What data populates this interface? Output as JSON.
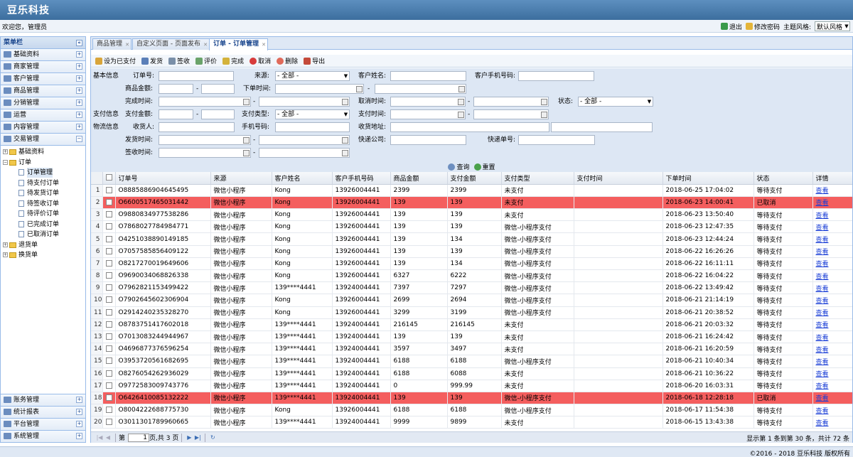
{
  "app": {
    "title": "豆乐科技"
  },
  "topbar": {
    "welcome": "欢迎您，管理员",
    "logout": "退出",
    "change_password": "修改密码",
    "theme_label": "主题风格:",
    "theme_value": "默认风格"
  },
  "sidebar": {
    "title": "菜单栏",
    "menu": [
      "基础资料",
      "商家管理",
      "客户管理",
      "商品管理",
      "分销管理",
      "运营",
      "内容管理",
      "交易管理"
    ],
    "tree": {
      "basic": "基础资料",
      "order": "订单",
      "order_children": [
        "订单管理",
        "待支付订单",
        "待发货订单",
        "待签收订单",
        "待评价订单",
        "已完成订单",
        "已取消订单"
      ],
      "refund": "退货单",
      "exchange": "换货单"
    },
    "bottom_menu": [
      "账务管理",
      "统计报表",
      "平台管理",
      "系统管理"
    ]
  },
  "tabs": [
    {
      "label": "商品管理"
    },
    {
      "label": "自定义页面 - 页面发布"
    },
    {
      "label": "订单 - 订单管理"
    }
  ],
  "toolbar": [
    "设为已支付",
    "发货",
    "签收",
    "评价",
    "完成",
    "取消",
    "删除",
    "导出"
  ],
  "form": {
    "basic_info": "基本信息",
    "order_no": "订单号:",
    "source": "来源:",
    "source_value": "- 全部 -",
    "customer_name": "客户姓名:",
    "customer_phone": "客户手机号码:",
    "amount": "商品金额:",
    "order_time": "下单时间:",
    "finish_time": "完成时间:",
    "cancel_time": "取消时间:",
    "status": "状态:",
    "status_value": "- 全部 -",
    "pay_info": "支付信息",
    "pay_amount": "支付金额:",
    "pay_type": "支付类型:",
    "pay_type_value": "- 全部 -",
    "pay_time": "支付时间:",
    "logistics_info": "物流信息",
    "receiver": "收货人:",
    "mobile": "手机号码:",
    "address": "收货地址:",
    "ship_time": "发货时间:",
    "express_company": "快递公司:",
    "express_no": "快递单号:",
    "sign_time": "签收时间:",
    "dash": "-",
    "query": "查询",
    "reset": "重置"
  },
  "grid": {
    "columns": [
      "订单号",
      "来源",
      "客户姓名",
      "客户手机号码",
      "商品金额",
      "支付金额",
      "支付类型",
      "支付时间",
      "下单时间",
      "状态",
      "详情"
    ],
    "rows": [
      {
        "n": "1",
        "id": "O8885886904645495",
        "src": "微信小程序",
        "name": "Kong",
        "phone": "13926004441",
        "amt": "2399",
        "pay": "2399",
        "ptype": "未支付",
        "ptime": "",
        "otime": "2018-06-25 17:04:02",
        "status": "等待支付",
        "detail": "查看",
        "hl": false
      },
      {
        "n": "2",
        "id": "O6600517465031442",
        "src": "微信小程序",
        "name": "Kong",
        "phone": "13926004441",
        "amt": "139",
        "pay": "139",
        "ptype": "未支付",
        "ptime": "",
        "otime": "2018-06-23 14:00:41",
        "status": "已取消",
        "detail": "查看",
        "hl": true
      },
      {
        "n": "3",
        "id": "O9880834977538286",
        "src": "微信小程序",
        "name": "Kong",
        "phone": "13926004441",
        "amt": "139",
        "pay": "139",
        "ptype": "未支付",
        "ptime": "",
        "otime": "2018-06-23 13:50:40",
        "status": "等待支付",
        "detail": "查看",
        "hl": false
      },
      {
        "n": "4",
        "id": "O7868027784984771",
        "src": "微信小程序",
        "name": "Kong",
        "phone": "13926004441",
        "amt": "139",
        "pay": "139",
        "ptype": "微信-小程序支付",
        "ptime": "",
        "otime": "2018-06-23 12:47:35",
        "status": "等待支付",
        "detail": "查看",
        "hl": false
      },
      {
        "n": "5",
        "id": "O4251038890149185",
        "src": "微信小程序",
        "name": "Kong",
        "phone": "13926004441",
        "amt": "139",
        "pay": "134",
        "ptype": "微信-小程序支付",
        "ptime": "",
        "otime": "2018-06-23 12:44:24",
        "status": "等待支付",
        "detail": "查看",
        "hl": false
      },
      {
        "n": "6",
        "id": "O7057585856409122",
        "src": "微信小程序",
        "name": "Kong",
        "phone": "13926004441",
        "amt": "139",
        "pay": "139",
        "ptype": "微信-小程序支付",
        "ptime": "",
        "otime": "2018-06-22 16:26:26",
        "status": "等待支付",
        "detail": "查看",
        "hl": false
      },
      {
        "n": "7",
        "id": "O8217270019649606",
        "src": "微信小程序",
        "name": "Kong",
        "phone": "13926004441",
        "amt": "139",
        "pay": "134",
        "ptype": "微信-小程序支付",
        "ptime": "",
        "otime": "2018-06-22 16:11:11",
        "status": "等待支付",
        "detail": "查看",
        "hl": false
      },
      {
        "n": "8",
        "id": "O9690034068826338",
        "src": "微信小程序",
        "name": "Kong",
        "phone": "13926004441",
        "amt": "6327",
        "pay": "6222",
        "ptype": "微信-小程序支付",
        "ptime": "",
        "otime": "2018-06-22 16:04:22",
        "status": "等待支付",
        "detail": "查看",
        "hl": false
      },
      {
        "n": "9",
        "id": "O7962821153499422",
        "src": "微信小程序",
        "name": "139****4441",
        "phone": "13924004441",
        "amt": "7397",
        "pay": "7297",
        "ptype": "微信-小程序支付",
        "ptime": "",
        "otime": "2018-06-22 13:49:42",
        "status": "等待支付",
        "detail": "查看",
        "hl": false
      },
      {
        "n": "10",
        "id": "O7902645602306904",
        "src": "微信小程序",
        "name": "Kong",
        "phone": "13926004441",
        "amt": "2699",
        "pay": "2694",
        "ptype": "微信-小程序支付",
        "ptime": "",
        "otime": "2018-06-21 21:14:19",
        "status": "等待支付",
        "detail": "查看",
        "hl": false
      },
      {
        "n": "11",
        "id": "O2914240235328270",
        "src": "微信小程序",
        "name": "Kong",
        "phone": "13926004441",
        "amt": "3299",
        "pay": "3199",
        "ptype": "微信-小程序支付",
        "ptime": "",
        "otime": "2018-06-21 20:38:52",
        "status": "等待支付",
        "detail": "查看",
        "hl": false
      },
      {
        "n": "12",
        "id": "O8783751417602018",
        "src": "微信小程序",
        "name": "139****4441",
        "phone": "13924004441",
        "amt": "216145",
        "pay": "216145",
        "ptype": "未支付",
        "ptime": "",
        "otime": "2018-06-21 20:03:32",
        "status": "等待支付",
        "detail": "查看",
        "hl": false
      },
      {
        "n": "13",
        "id": "O7013083244944967",
        "src": "微信小程序",
        "name": "139****4441",
        "phone": "13924004441",
        "amt": "139",
        "pay": "139",
        "ptype": "未支付",
        "ptime": "",
        "otime": "2018-06-21 16:24:42",
        "status": "等待支付",
        "detail": "查看",
        "hl": false
      },
      {
        "n": "14",
        "id": "O4696877376596254",
        "src": "微信小程序",
        "name": "139****4441",
        "phone": "13924004441",
        "amt": "3597",
        "pay": "3497",
        "ptype": "未支付",
        "ptime": "",
        "otime": "2018-06-21 16:20:59",
        "status": "等待支付",
        "detail": "查看",
        "hl": false
      },
      {
        "n": "15",
        "id": "O3953720561682695",
        "src": "微信小程序",
        "name": "139****4441",
        "phone": "13924004441",
        "amt": "6188",
        "pay": "6188",
        "ptype": "微信-小程序支付",
        "ptime": "",
        "otime": "2018-06-21 10:40:34",
        "status": "等待支付",
        "detail": "查看",
        "hl": false
      },
      {
        "n": "16",
        "id": "O8276054262936029",
        "src": "微信小程序",
        "name": "139****4441",
        "phone": "13924004441",
        "amt": "6188",
        "pay": "6088",
        "ptype": "未支付",
        "ptime": "",
        "otime": "2018-06-21 10:36:22",
        "status": "等待支付",
        "detail": "查看",
        "hl": false
      },
      {
        "n": "17",
        "id": "O9772583009743776",
        "src": "微信小程序",
        "name": "139****4441",
        "phone": "13924004441",
        "amt": "0",
        "pay": "999.99",
        "ptype": "未支付",
        "ptime": "",
        "otime": "2018-06-20 16:03:31",
        "status": "等待支付",
        "detail": "查看",
        "hl": false
      },
      {
        "n": "18",
        "id": "O6426410085132222",
        "src": "微信小程序",
        "name": "139****4441",
        "phone": "13924004441",
        "amt": "139",
        "pay": "139",
        "ptype": "微信-小程序支付",
        "ptime": "",
        "otime": "2018-06-18 12:28:18",
        "status": "已取消",
        "detail": "查看",
        "hl": true
      },
      {
        "n": "19",
        "id": "O8004222688775730",
        "src": "微信小程序",
        "name": "Kong",
        "phone": "13926004441",
        "amt": "6188",
        "pay": "6188",
        "ptype": "微信-小程序支付",
        "ptime": "",
        "otime": "2018-06-17 11:54:38",
        "status": "等待支付",
        "detail": "查看",
        "hl": false
      },
      {
        "n": "20",
        "id": "O3011301789960665",
        "src": "微信小程序",
        "name": "139****4441",
        "phone": "13924004441",
        "amt": "9999",
        "pay": "9899",
        "ptype": "未支付",
        "ptime": "",
        "otime": "2018-06-15 13:43:38",
        "status": "等待支付",
        "detail": "查看",
        "hl": false
      }
    ]
  },
  "pager": {
    "label_page": "第",
    "page": "1",
    "label_total": "页,共 3 页",
    "info": "显示第 1 条到第 30 条，共计 72 条"
  },
  "footer": {
    "copyright": "©2016 - 2018 豆乐科技 版权所有"
  },
  "colors": {
    "header": "#4a7db0",
    "highlight_row": "#f45e5e",
    "link": "#1a3ed6"
  }
}
